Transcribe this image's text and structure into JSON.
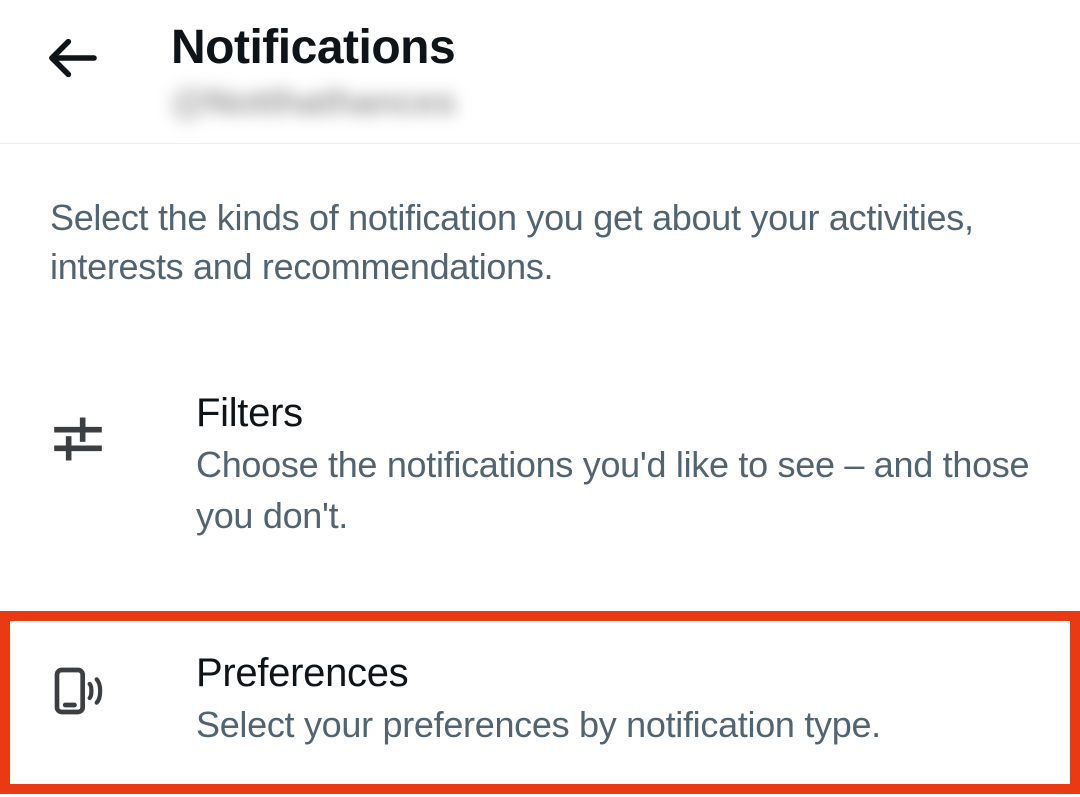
{
  "header": {
    "title": "Notifications",
    "subtitle": "@Notthathances"
  },
  "description": "Select the kinds of notification you get about your activities, interests and recommendations.",
  "items": {
    "filters": {
      "title": "Filters",
      "desc": "Choose the notifications you'd like to see – and those you don't."
    },
    "preferences": {
      "title": "Preferences",
      "desc": "Select your preferences by notification type."
    }
  }
}
